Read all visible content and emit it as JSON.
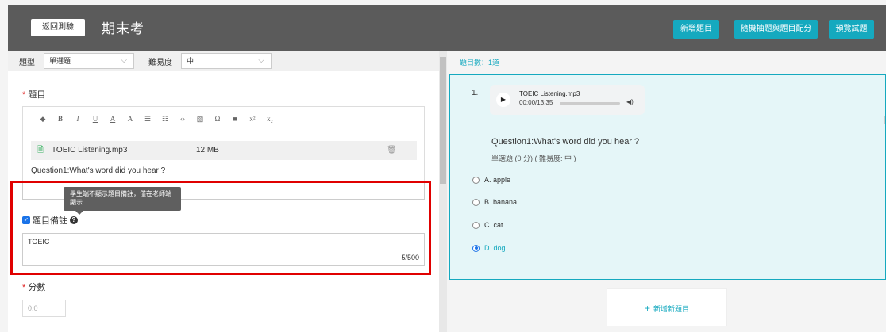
{
  "header": {
    "back_label": "返回測驗",
    "title": "期末考",
    "buttons": [
      "新增題目",
      "隨機抽題與題目配分",
      "預覽試題"
    ],
    "accent_color": "#15a9bf"
  },
  "filters": {
    "type_label": "題型",
    "type_value": "單選題",
    "difficulty_label": "難易度",
    "difficulty_value": "中"
  },
  "question_section": {
    "label": "題目",
    "toolbar_icons": [
      "eraser-icon",
      "bold-icon",
      "italic-icon",
      "underline-icon",
      "font-color-icon",
      "font-size-icon",
      "ordered-list-icon",
      "bullet-list-icon",
      "code-icon",
      "image-icon",
      "omega-icon",
      "video-icon",
      "superscript-icon",
      "subscript-icon"
    ],
    "file_name": "TOEIC Listening.mp3",
    "file_size": "12 MB",
    "text": "Question1:What's word did you hear ?"
  },
  "tooltip": "學生端不顯示題目備註，僅在老師端顯示",
  "remark": {
    "label": "題目備註",
    "checked": true,
    "value": "TOEIC",
    "counter": "5/500"
  },
  "score": {
    "label": "分數",
    "placeholder": "0.0"
  },
  "preview": {
    "count_label": "題目數：1道",
    "number": "1.",
    "audio_name": "TOEIC Listening.mp3",
    "audio_time": "00:00/13:35",
    "question": "Question1:What's word did you hear ?",
    "meta": "單選題 (0 分) ( 難易度: 中 )",
    "options": [
      {
        "label": "A. apple",
        "selected": false
      },
      {
        "label": "B. banana",
        "selected": false
      },
      {
        "label": "C. cat",
        "selected": false
      },
      {
        "label": "D. dog",
        "selected": true
      }
    ],
    "add_label": "新增新題目"
  }
}
